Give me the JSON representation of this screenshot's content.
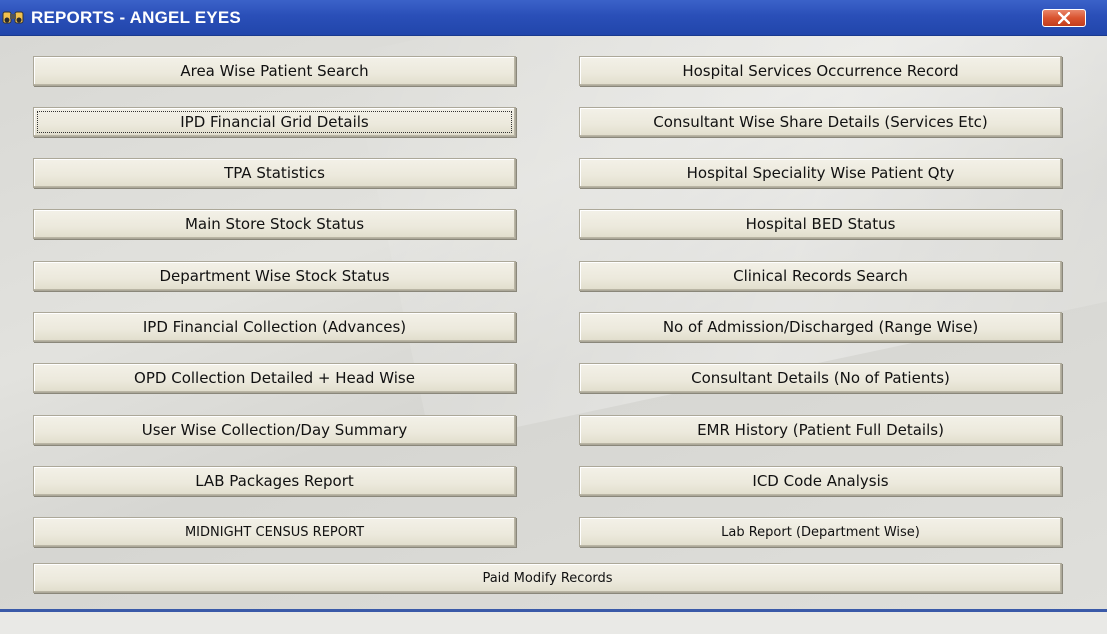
{
  "window": {
    "title": "REPORTS - ANGEL EYES",
    "icon": "binoculars-icon",
    "close_icon": "close-icon"
  },
  "buttons": {
    "left": [
      "Area Wise Patient Search",
      "IPD Financial Grid Details",
      "TPA Statistics",
      "Main Store Stock Status",
      "Department Wise Stock Status",
      "IPD Financial Collection (Advances)",
      "OPD Collection Detailed + Head Wise",
      "User Wise Collection/Day Summary",
      "LAB Packages Report",
      "MIDNIGHT CENSUS REPORT"
    ],
    "right": [
      "Hospital Services Occurrence Record",
      "Consultant Wise Share Details (Services Etc)",
      "Hospital Speciality Wise Patient Qty",
      "Hospital BED Status",
      "Clinical Records Search",
      "No of Admission/Discharged (Range Wise)",
      "Consultant Details (No of Patients)",
      "EMR History (Patient Full Details)",
      "ICD Code Analysis",
      "Lab Report (Department Wise)"
    ],
    "bottom": "Paid Modify Records"
  },
  "colors": {
    "titlebar": "#2a4fb8",
    "close": "#d9532f",
    "button_face": "#ece9dc"
  }
}
